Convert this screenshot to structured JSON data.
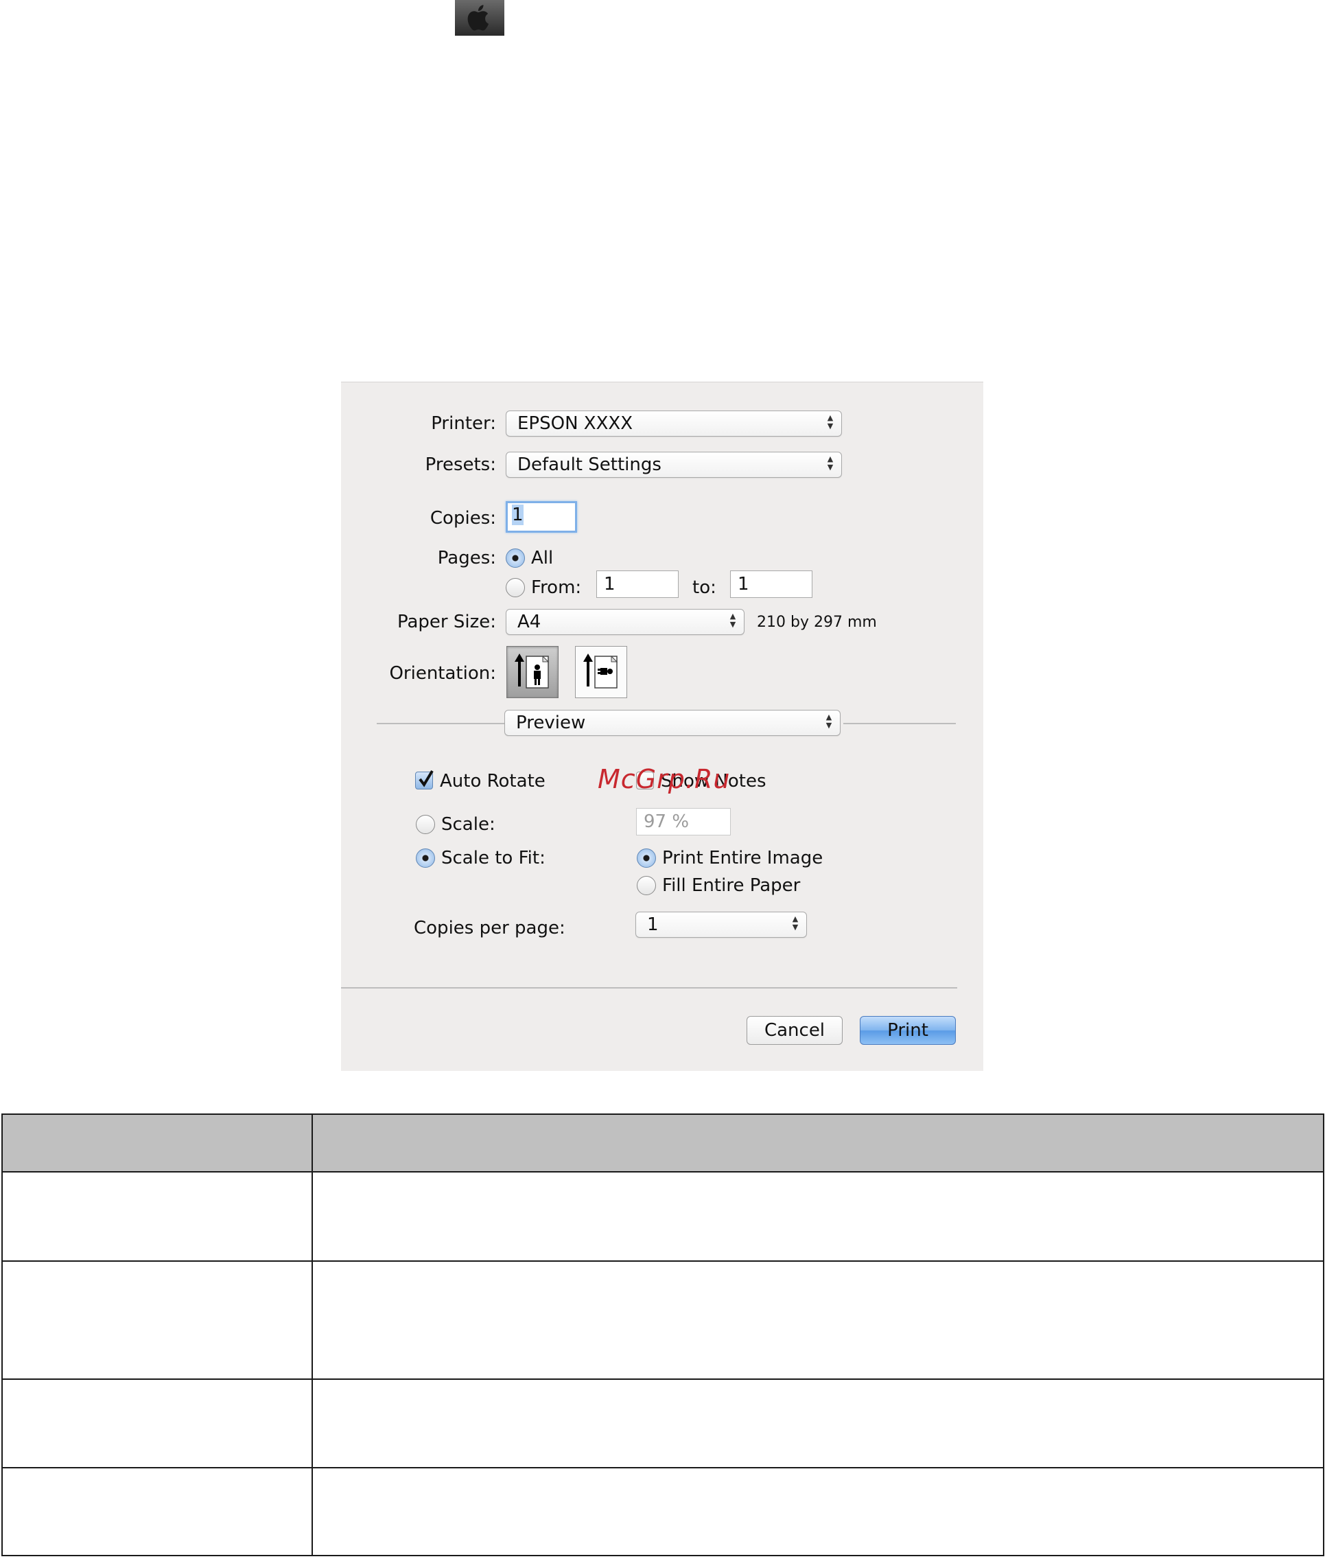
{
  "icons": {
    "top": "apple-icon"
  },
  "dialog": {
    "printer": {
      "label": "Printer:",
      "value": "EPSON XXXX"
    },
    "presets": {
      "label": "Presets:",
      "value": "Default Settings"
    },
    "copies": {
      "label": "Copies:",
      "value": "1"
    },
    "pages": {
      "label": "Pages:",
      "all_label": "All",
      "from_label": "From:",
      "from_value": "1",
      "to_label": "to:",
      "to_value": "1",
      "selected": "All"
    },
    "paper_size": {
      "label": "Paper Size:",
      "value": "A4",
      "dimensions": "210 by 297 mm"
    },
    "orientation": {
      "label": "Orientation:",
      "selected": "portrait"
    },
    "section_popup": {
      "value": "Preview"
    },
    "auto_rotate": {
      "label": "Auto Rotate",
      "checked": true
    },
    "show_notes": {
      "label": "Show Notes",
      "checked": false
    },
    "scale": {
      "label": "Scale:",
      "value": "97 %"
    },
    "scale_to_fit": {
      "label": "Scale to Fit:",
      "selected": true
    },
    "print_entire_image": {
      "label": "Print Entire Image",
      "selected": true
    },
    "fill_entire_paper": {
      "label": "Fill Entire Paper",
      "selected": false
    },
    "copies_per_page": {
      "label": "Copies per page:",
      "value": "1"
    },
    "buttons": {
      "cancel": "Cancel",
      "print": "Print"
    }
  },
  "watermark": "McGrp.Ru",
  "colors": {
    "accent": "#5a9be6",
    "table_header": "#c0c0c0",
    "watermark": "#c8282f"
  }
}
